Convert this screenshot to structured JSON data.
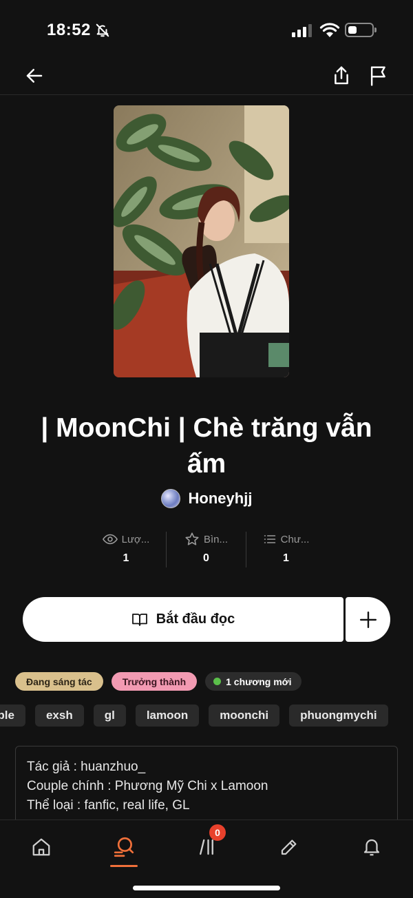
{
  "status_bar": {
    "time": "18:52",
    "signal_bars_active": 3,
    "signal_bars_total": 4,
    "battery_level": 0.35
  },
  "story": {
    "title": "| MoonChi | Chè trăng vẫn ấm",
    "author": "Honeyhjj"
  },
  "stats": [
    {
      "icon": "eye-icon",
      "label": "Lượ...",
      "value": "1"
    },
    {
      "icon": "star-icon",
      "label": "Bìn...",
      "value": "0"
    },
    {
      "icon": "list-icon",
      "label": "Chư...",
      "value": "1"
    }
  ],
  "actions": {
    "read_label": "Bắt đầu đọc"
  },
  "badges": {
    "status": "Đang sáng tác",
    "mature": "Trưởng thành",
    "new_chapter": "1 chương mới"
  },
  "tags": [
    "uple",
    "exsh",
    "gl",
    "lamoon",
    "moonchi",
    "phuongmychi"
  ],
  "description": [
    "Tác giả : huanzhuo_",
    "Couple chính : Phương Mỹ Chi x Lamoon",
    "Thể loại : fanfic, real life, GL"
  ],
  "bottom_nav": {
    "notification_count": "0",
    "active": "search"
  },
  "colors": {
    "background": "#121212",
    "accent": "#f0703a",
    "badge_writing": "#d9c08c",
    "badge_mature": "#f29ab2",
    "new_dot": "#5bbf4a",
    "notification": "#e8412c"
  }
}
